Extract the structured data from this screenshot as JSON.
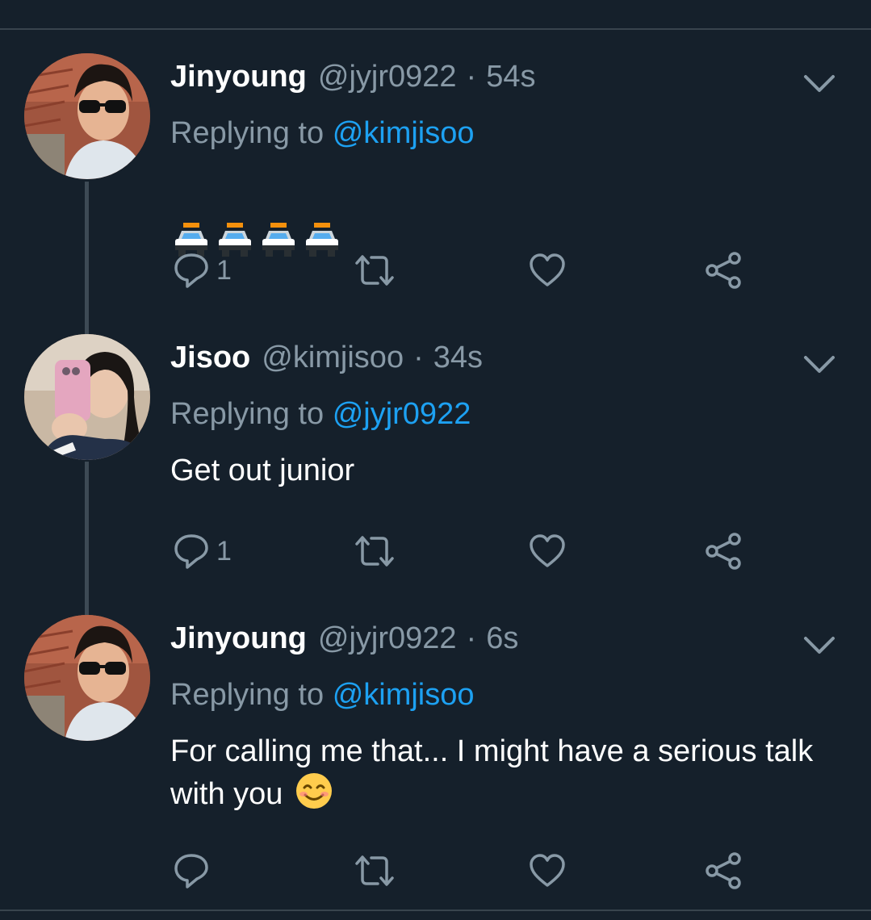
{
  "colors": {
    "background": "#15202b",
    "secondary_text": "#8899a6",
    "accent": "#1da1f2",
    "divider": "#38444d"
  },
  "tweets": [
    {
      "name": "Jinyoung",
      "handle": "@jyjr0922",
      "dot": "·",
      "time": "54s",
      "replying_label": "Replying to",
      "replying_to": "@kimjisoo",
      "text": "",
      "emoji": [
        "police-car-emoji",
        "police-car-emoji",
        "police-car-emoji",
        "police-car-emoji"
      ],
      "reply_count": "1",
      "icons": [
        "reply-icon",
        "retweet-icon",
        "like-icon",
        "share-icon",
        "chevron-down-icon"
      ]
    },
    {
      "name": "Jisoo",
      "handle": "@kimjisoo",
      "dot": "·",
      "time": "34s",
      "replying_label": "Replying to",
      "replying_to": "@jyjr0922",
      "text": "Get out junior",
      "reply_count": "1",
      "icons": [
        "reply-icon",
        "retweet-icon",
        "like-icon",
        "share-icon",
        "chevron-down-icon"
      ]
    },
    {
      "name": "Jinyoung",
      "handle": "@jyjr0922",
      "dot": "·",
      "time": "6s",
      "replying_label": "Replying to",
      "replying_to": "@kimjisoo",
      "text": "For calling me that... I might have a serious talk with you",
      "emoji": [
        "smiling-face-emoji"
      ],
      "reply_count": "",
      "icons": [
        "reply-icon",
        "retweet-icon",
        "like-icon",
        "share-icon",
        "chevron-down-icon"
      ]
    }
  ]
}
